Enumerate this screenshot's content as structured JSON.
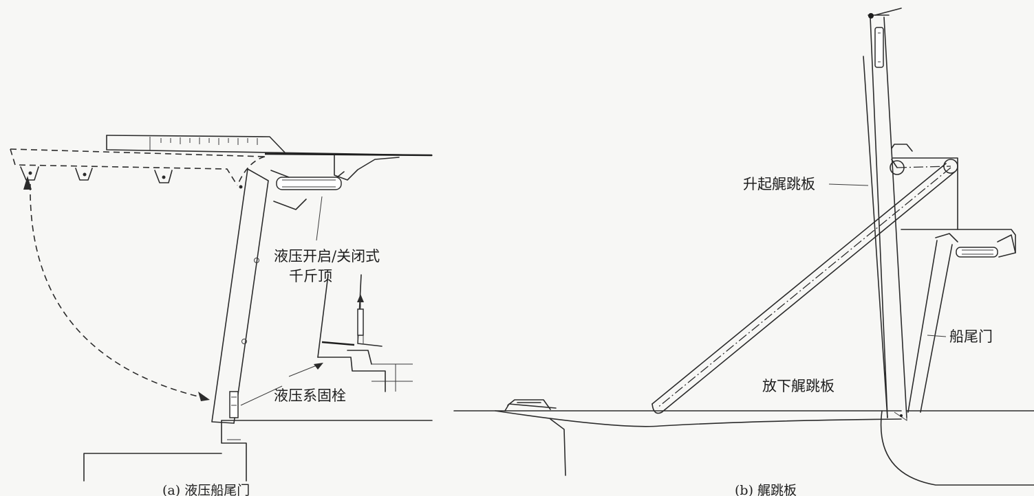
{
  "panel_a": {
    "caption": "(a) 液压船尾门",
    "label_jack_line1": "液压开启/关闭式",
    "label_jack_line2": "千斤顶",
    "label_cleat": "液压系固栓"
  },
  "panel_b": {
    "caption": "(b) 艉跳板",
    "label_raised_ramp": "升起艉跳板",
    "label_stern_door": "船尾门",
    "label_lowered_ramp": "放下艉跳板"
  }
}
